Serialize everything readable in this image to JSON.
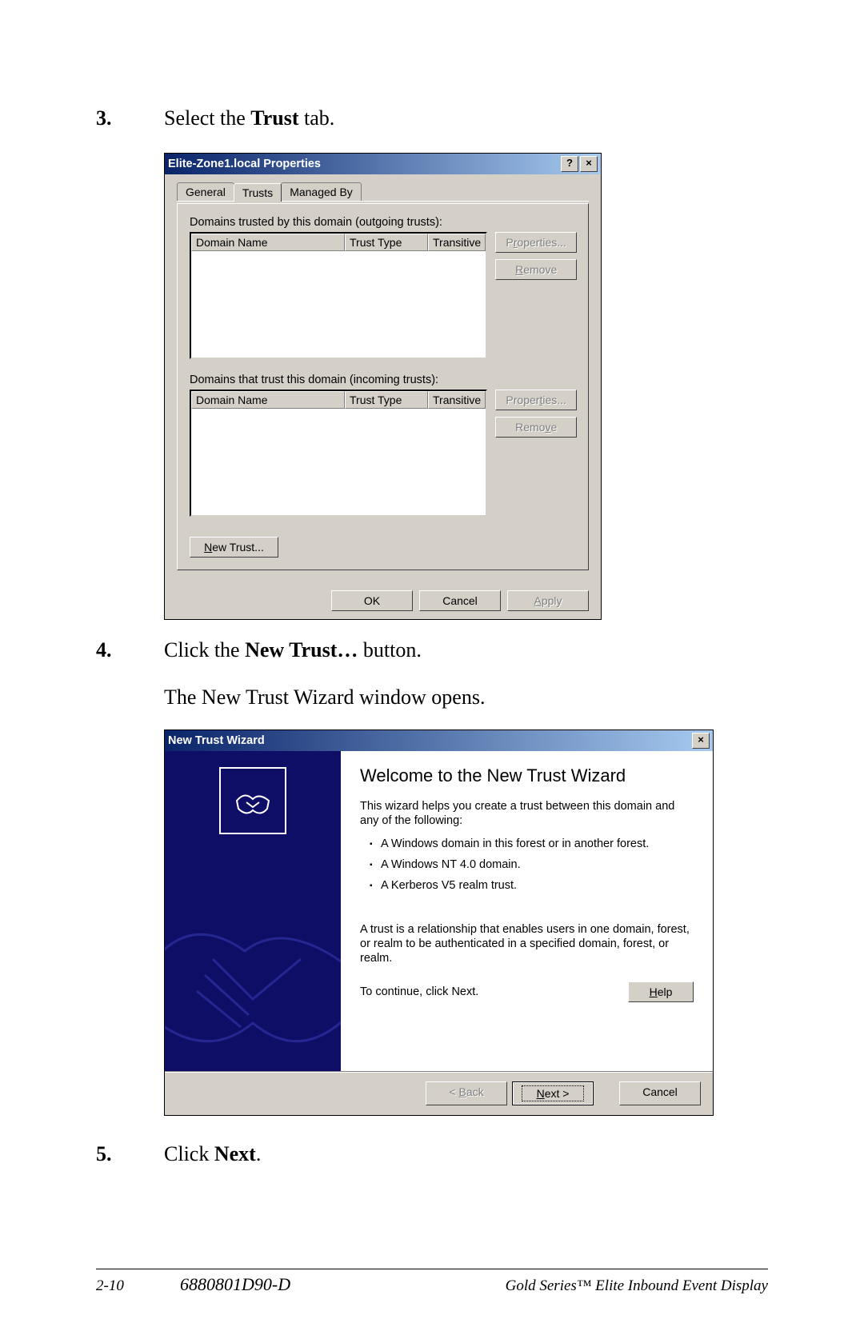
{
  "steps": {
    "s3_num": "3.",
    "s3_pre": "Select the ",
    "s3_bold": "Trust",
    "s3_post": " tab.",
    "s4_num": "4.",
    "s4_pre": "Click the ",
    "s4_bold": "New Trust…",
    "s4_post": " button.",
    "s4_sub": "The New Trust Wizard window opens.",
    "s5_num": "5.",
    "s5_pre": "Click ",
    "s5_bold": "Next",
    "s5_post": "."
  },
  "dlg1": {
    "title": "Elite-Zone1.local Properties",
    "help": "?",
    "close": "×",
    "tabs": {
      "general": "General",
      "trusts": "Trusts",
      "managed": "Managed By"
    },
    "outgoing_label": "Domains trusted by this domain (outgoing trusts):",
    "incoming_label": "Domains that trust this domain (incoming trusts):",
    "cols": {
      "name": "Domain Name",
      "type": "Trust Type",
      "trans": "Transitive"
    },
    "btn_properties": "Properties...",
    "btn_remove": "Remove",
    "btn_newtrust": "New Trust...",
    "btn_ok": "OK",
    "btn_cancel": "Cancel",
    "btn_apply": "Apply"
  },
  "wiz": {
    "title": "New Trust Wizard",
    "close": "×",
    "heading": "Welcome to the New Trust Wizard",
    "intro": "This wizard helps you create a trust between this domain and any of the following:",
    "items": [
      "A Windows domain in this forest or in another forest.",
      "A Windows NT 4.0 domain.",
      "A Kerberos V5 realm trust."
    ],
    "trust_desc": "A trust is a relationship that enables users in one domain, forest, or realm to be authenticated in a specified domain, forest, or realm.",
    "continue": "To continue, click Next.",
    "btn_help": "Help",
    "btn_back": "< Back",
    "btn_next": "Next >",
    "btn_cancel": "Cancel"
  },
  "footer": {
    "pagenum": "2-10",
    "docid": "6880801D90-D",
    "product": "Gold Series™ Elite Inbound Event Display"
  }
}
